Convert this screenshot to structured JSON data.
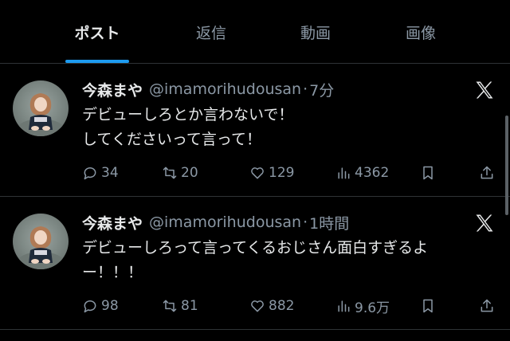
{
  "tabs": [
    {
      "label": "ポスト",
      "active": true
    },
    {
      "label": "返信",
      "active": false
    },
    {
      "label": "動画",
      "active": false
    },
    {
      "label": "画像",
      "active": false
    }
  ],
  "tweets": [
    {
      "name": "今森まや",
      "handle": "@imamorihudousan",
      "dot": "·",
      "time": "7分",
      "lines": [
        "デビューしろとか言わないで！",
        "してくださいって言って！"
      ],
      "replies": "34",
      "reposts": "20",
      "likes": "129",
      "views": "4362"
    },
    {
      "name": "今森まや",
      "handle": "@imamorihudousan",
      "dot": "·",
      "time": "1時間",
      "lines": [
        "デビューしろって言ってくるおじさん面白すぎるよ",
        "ー！！！"
      ],
      "replies": "98",
      "reposts": "81",
      "likes": "882",
      "views": "9.6万"
    }
  ],
  "colors": {
    "background": "#000000",
    "accent": "#1d9bf0",
    "text": "#e7e9ea",
    "muted": "#8b98a5",
    "divider": "#2f3336"
  },
  "icons": {
    "reply": "reply-icon",
    "repost": "repost-icon",
    "like": "heart-icon",
    "views": "views-icon",
    "bookmark": "bookmark-icon",
    "share": "share-icon",
    "x_logo": "x-logo-icon"
  }
}
